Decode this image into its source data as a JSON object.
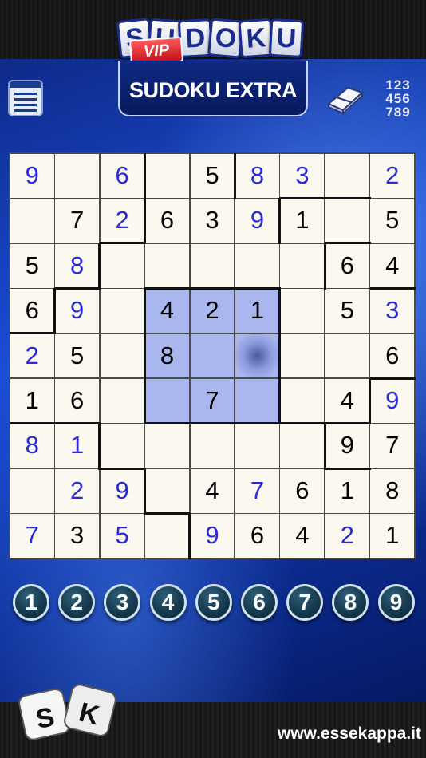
{
  "app": {
    "logo_letters": [
      "S",
      "U",
      "D",
      "O",
      "K",
      "U"
    ],
    "logo_badge": "VIP",
    "mode_title": "SUDOKU EXTRA"
  },
  "toolbar": {
    "menu_icon": "list-menu-icon",
    "eraser_icon": "eraser-icon",
    "numbers_toggle": [
      "123",
      "456",
      "789"
    ]
  },
  "board": {
    "rows": [
      [
        "9",
        "",
        "6",
        "",
        "5",
        "8",
        "3",
        "",
        "2"
      ],
      [
        "",
        "7",
        "2",
        "6",
        "3",
        "9",
        "1",
        "",
        "5"
      ],
      [
        "5",
        "8",
        "",
        "",
        "",
        "",
        "",
        "6",
        "4"
      ],
      [
        "6",
        "9",
        "",
        "4",
        "2",
        "1",
        "",
        "5",
        "3"
      ],
      [
        "2",
        "5",
        "",
        "8",
        "",
        "",
        "",
        "",
        "6"
      ],
      [
        "1",
        "6",
        "",
        "",
        "7",
        "",
        "",
        "4",
        "9"
      ],
      [
        "8",
        "1",
        "",
        "",
        "",
        "",
        "",
        "9",
        "7"
      ],
      [
        "",
        "2",
        "9",
        "",
        "4",
        "7",
        "6",
        "1",
        "8"
      ],
      [
        "7",
        "3",
        "5",
        "",
        "9",
        "6",
        "4",
        "2",
        "1"
      ]
    ],
    "user_entered": [
      [
        0,
        0
      ],
      [
        0,
        2
      ],
      [
        0,
        5
      ],
      [
        0,
        6
      ],
      [
        0,
        8
      ],
      [
        1,
        2
      ],
      [
        1,
        5
      ],
      [
        2,
        1
      ],
      [
        3,
        1
      ],
      [
        3,
        8
      ],
      [
        4,
        0
      ],
      [
        5,
        8
      ],
      [
        6,
        0
      ],
      [
        6,
        1
      ],
      [
        7,
        1
      ],
      [
        7,
        2
      ],
      [
        7,
        5
      ],
      [
        8,
        0
      ],
      [
        8,
        2
      ],
      [
        8,
        4
      ],
      [
        8,
        7
      ]
    ],
    "selected_cell": [
      4,
      5
    ],
    "highlighted_cells": [
      [
        3,
        3
      ],
      [
        3,
        4
      ],
      [
        3,
        5
      ],
      [
        4,
        3
      ],
      [
        4,
        4
      ],
      [
        4,
        5
      ],
      [
        5,
        3
      ],
      [
        5,
        4
      ],
      [
        5,
        5
      ]
    ],
    "colors": {
      "given": "#000000",
      "user": "#2a2ad6",
      "highlight": "#aab6ee",
      "cell": "#fbf8ef"
    }
  },
  "digit_buttons": [
    "1",
    "2",
    "3",
    "4",
    "5",
    "6",
    "7",
    "8",
    "9"
  ],
  "footer": {
    "dice_icon": "dice-logo-icon",
    "website": "www.essekappa.it"
  }
}
